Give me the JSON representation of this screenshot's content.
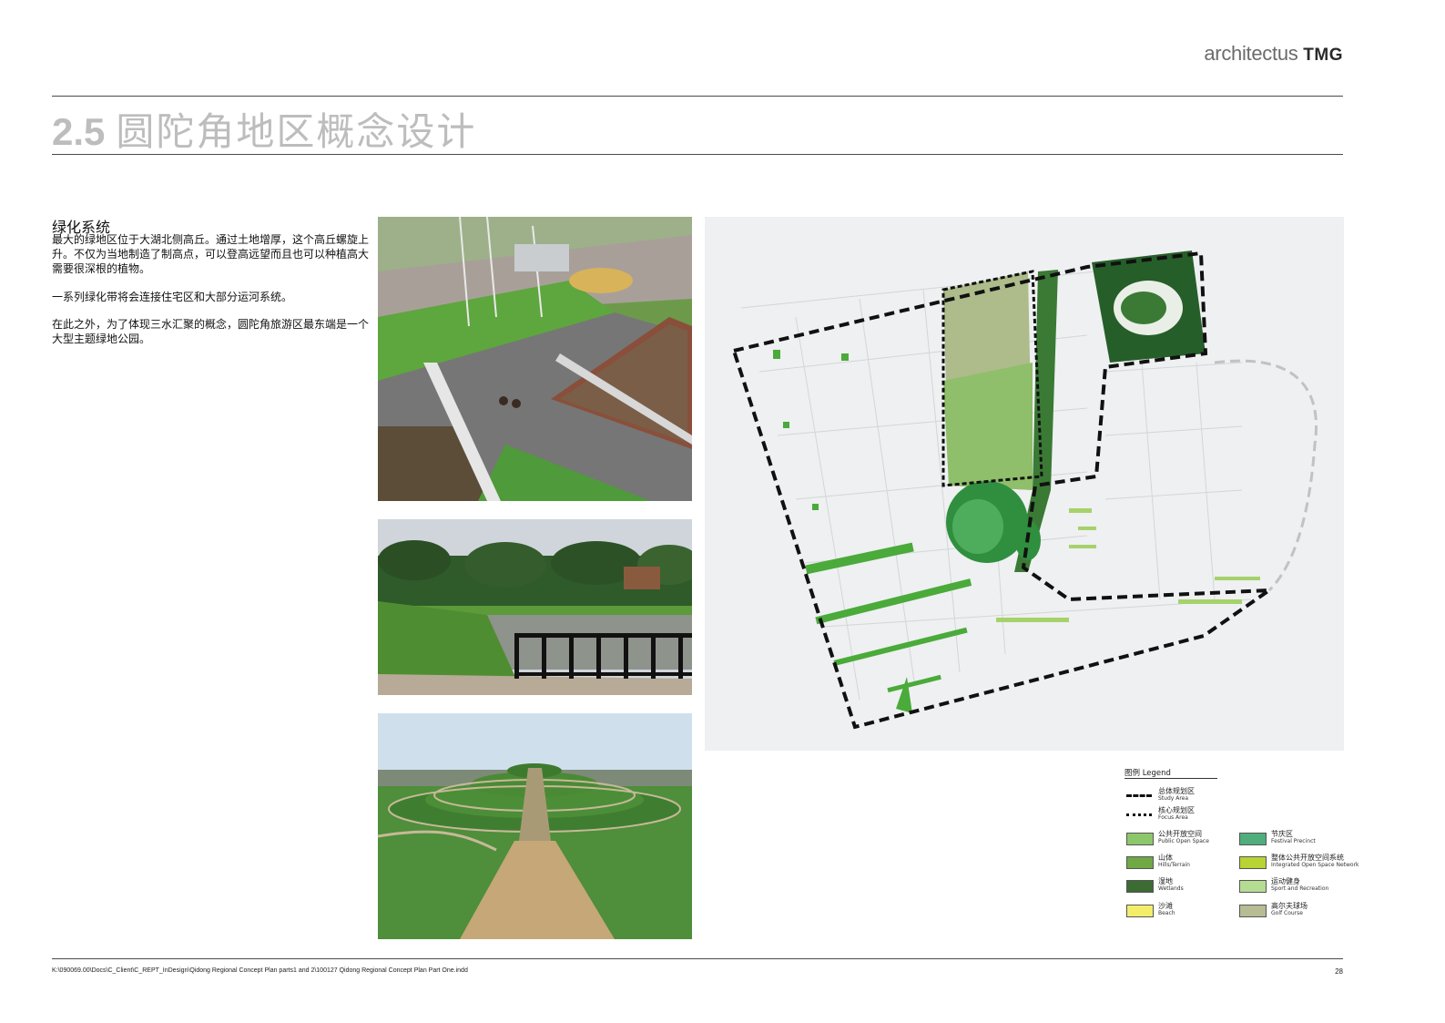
{
  "brand": {
    "name": "architectus",
    "suffix": "TMG"
  },
  "title": {
    "number": "2.5",
    "text": "圆陀角地区概念设计"
  },
  "section": {
    "heading": "绿化系统",
    "paragraphs": [
      "最大的绿地区位于大湖北侧高丘。通过土地增厚，这个高丘螺旋上升。不仅为当地制造了制高点，可以登高远望而且也可以种植高大需要很深根的植物。",
      "一系列绿化带将会连接住宅区和大部分运河系统。",
      "在此之外，为了体现三水汇聚的概念，圆陀角旅游区最东端是一个大型主题绿地公园。"
    ]
  },
  "legend": {
    "title": "图例 Legend",
    "lines": [
      {
        "cn": "总体规划区",
        "en": "Study Area"
      },
      {
        "cn": "核心规划区",
        "en": "Focus Area"
      }
    ],
    "items_left": [
      {
        "cn": "公共开放空间",
        "en": "Public Open Space",
        "color": "#8cc86b"
      },
      {
        "cn": "山体",
        "en": "Hills/Terrain",
        "color": "#6fa845"
      },
      {
        "cn": "湿地",
        "en": "Wetlands",
        "color": "#3c6b33"
      },
      {
        "cn": "沙滩",
        "en": "Beach",
        "color": "#f3ee6a"
      }
    ],
    "items_right": [
      {
        "cn": "节庆区",
        "en": "Festival Precinct",
        "color": "#4fae7c"
      },
      {
        "cn": "整体公共开放空间系统",
        "en": "Integrated Open Space Network",
        "color": "#b7d334"
      },
      {
        "cn": "运动健身",
        "en": "Sport and Recreation",
        "color": "#b5dc93"
      },
      {
        "cn": "高尔夫球场",
        "en": "Golf Course",
        "color": "#b7bc94"
      }
    ]
  },
  "footer": {
    "path": "K:\\090069.00\\Docs\\C_Client\\C_REPT_InDesign\\Qidong Regional Concept Plan parts1 and 2\\100127 Qidong Regional Concept Plan Part One.indd",
    "page": "28"
  }
}
